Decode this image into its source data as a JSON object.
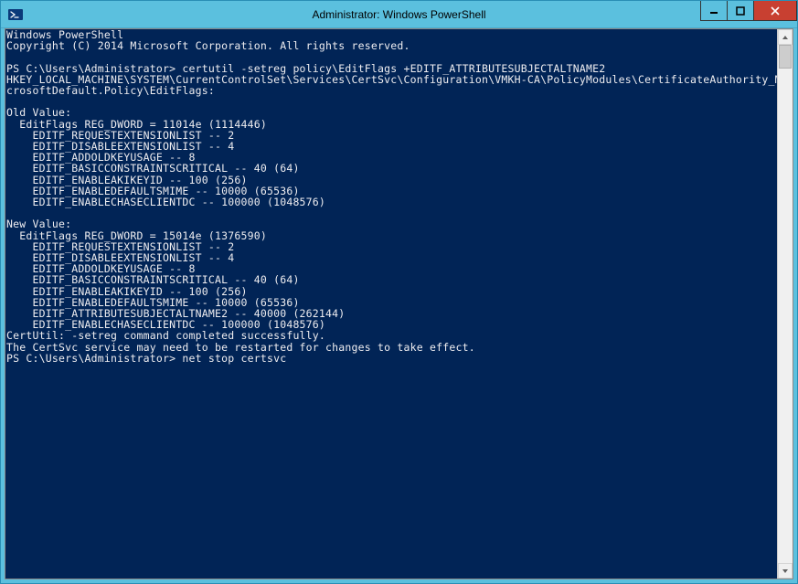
{
  "titlebar": {
    "title": "Administrator: Windows PowerShell"
  },
  "console": {
    "header1": "Windows PowerShell",
    "header2": "Copyright (C) 2014 Microsoft Corporation. All rights reserved.",
    "prompt1": "PS C:\\Users\\Administrator> certutil -setreg policy\\EditFlags +EDITF_ATTRIBUTESUBJECTALTNAME2",
    "regpath1": "HKEY_LOCAL_MACHINE\\SYSTEM\\CurrentControlSet\\Services\\CertSvc\\Configuration\\VMKH-CA\\PolicyModules\\CertificateAuthority_Mi",
    "regpath2": "crosoftDefault.Policy\\EditFlags:",
    "oldvalue_hdr": "Old Value:",
    "old_l1": "  EditFlags REG_DWORD = 11014e (1114446)",
    "old_l2": "    EDITF_REQUESTEXTENSIONLIST -- 2",
    "old_l3": "    EDITF_DISABLEEXTENSIONLIST -- 4",
    "old_l4": "    EDITF_ADDOLDKEYUSAGE -- 8",
    "old_l5": "    EDITF_BASICCONSTRAINTSCRITICAL -- 40 (64)",
    "old_l6": "    EDITF_ENABLEAKIKEYID -- 100 (256)",
    "old_l7": "    EDITF_ENABLEDEFAULTSMIME -- 10000 (65536)",
    "old_l8": "    EDITF_ENABLECHASECLIENTDC -- 100000 (1048576)",
    "newvalue_hdr": "New Value:",
    "new_l1": "  EditFlags REG_DWORD = 15014e (1376590)",
    "new_l2": "    EDITF_REQUESTEXTENSIONLIST -- 2",
    "new_l3": "    EDITF_DISABLEEXTENSIONLIST -- 4",
    "new_l4": "    EDITF_ADDOLDKEYUSAGE -- 8",
    "new_l5": "    EDITF_BASICCONSTRAINTSCRITICAL -- 40 (64)",
    "new_l6": "    EDITF_ENABLEAKIKEYID -- 100 (256)",
    "new_l7": "    EDITF_ENABLEDEFAULTSMIME -- 10000 (65536)",
    "new_l8": "    EDITF_ATTRIBUTESUBJECTALTNAME2 -- 40000 (262144)",
    "new_l9": "    EDITF_ENABLECHASECLIENTDC -- 100000 (1048576)",
    "result1": "CertUtil: -setreg command completed successfully.",
    "result2": "The CertSvc service may need to be restarted for changes to take effect.",
    "prompt2": "PS C:\\Users\\Administrator> net stop certsvc"
  }
}
